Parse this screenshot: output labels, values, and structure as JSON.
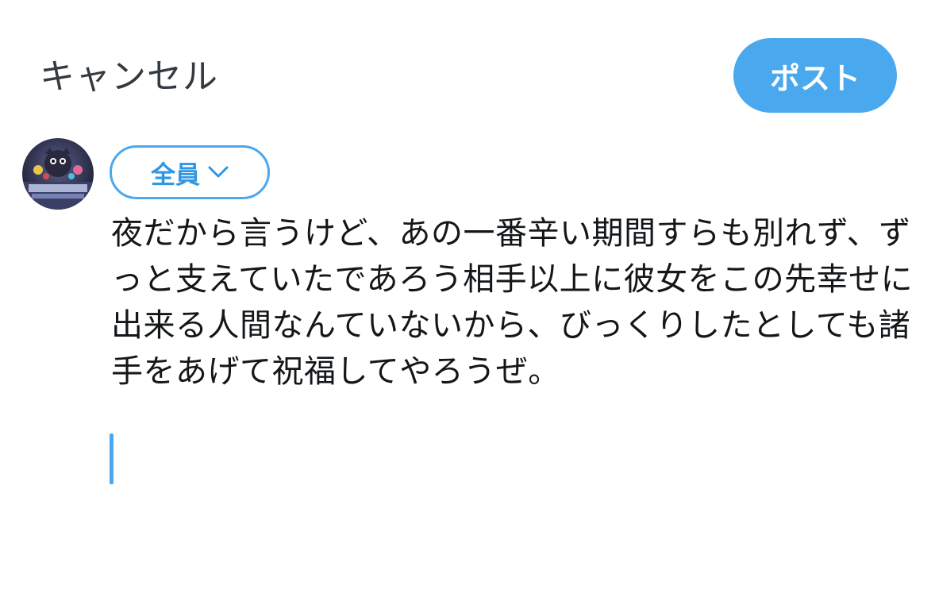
{
  "header": {
    "cancel_label": "キャンセル",
    "post_label": "ポスト"
  },
  "composer": {
    "audience_label": "全員",
    "text": "夜だから言うけど、あの一番辛い期間すらも別れず、ずっと支えていたであろう相手以上に彼女をこの先幸せに出来る人間なんていないから、びっくりしたとしても諸手をあげて祝福してやろうぜ。"
  },
  "colors": {
    "accent": "#4aa8ee",
    "text": "#14171a",
    "cancel_text": "#333a40"
  },
  "icons": {
    "avatar": "user-avatar",
    "audience_chevron": "chevron-down-icon"
  }
}
